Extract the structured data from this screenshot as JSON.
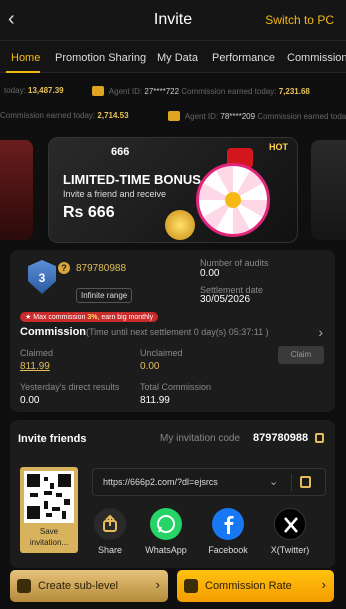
{
  "header": {
    "title": "Invite",
    "switch_label": "Switch to PC"
  },
  "tabs": [
    {
      "label": "Home"
    },
    {
      "label": "Promotion Sharing"
    },
    {
      "label": "My Data"
    },
    {
      "label": "Performance"
    },
    {
      "label": "Commission"
    }
  ],
  "ticker1": [
    {
      "text": "today:",
      "value": "13,487.39"
    },
    {
      "text": "Agent ID:",
      "id": "27****722",
      "text2": "Commission earned today:",
      "value": "7,231.68"
    }
  ],
  "ticker2": [
    {
      "text": "Commission earned today:",
      "value": "2,714.53"
    },
    {
      "text": "Agent ID:",
      "id": "78****209",
      "text2": "Commission earned today:"
    }
  ],
  "banner": {
    "logo": "666",
    "title": "LIMITED-TIME BONUS",
    "subtitle": "Invite a friend and receive",
    "amount": "Rs 666",
    "hot": "HOT"
  },
  "agent": {
    "level": "3",
    "id": "879780988",
    "range": "Infinite range",
    "audits_label": "Number of audits",
    "audits_value": "0.00",
    "settlement_label": "Settlement date",
    "settlement_value": "30/05/2026",
    "max_text_pre": "Max commission ",
    "max_pct": "3%",
    "max_text_post": ", earn big monthly"
  },
  "commission": {
    "title": "Commission",
    "countdown": "(Time until next settlement   0 day(s) 05:37:11 )",
    "claimed_label": "Claimed",
    "claimed_value": "811.99",
    "unclaimed_label": "Unclaimed",
    "unclaimed_value": "0.00",
    "claim_button": "Claim",
    "direct_label": "Yesterday's direct results",
    "direct_value": "0.00",
    "total_label": "Total Commission",
    "total_value": "811.99"
  },
  "invite": {
    "title": "Invite friends",
    "code_label": "My invitation code",
    "code": "879780988",
    "save_label": "Save invitation...",
    "link": "https://666p2.com/?dl=ejsrcs",
    "share": [
      {
        "label": "Share",
        "icon": "share-icon",
        "color": "#2a2a2a"
      },
      {
        "label": "WhatsApp",
        "icon": "whatsapp-icon",
        "color": "#25d366"
      },
      {
        "label": "Facebook",
        "icon": "facebook-icon",
        "color": "#1877f2"
      },
      {
        "label": "X(Twitter)",
        "icon": "x-twitter-icon",
        "color": "#000000"
      }
    ]
  },
  "bottom": {
    "create_label": "Create sub-level",
    "rate_label": "Commission Rate"
  },
  "colors": {
    "accent": "#f5b915",
    "bg": "#0f0f0f",
    "card": "#1c1c1c"
  }
}
